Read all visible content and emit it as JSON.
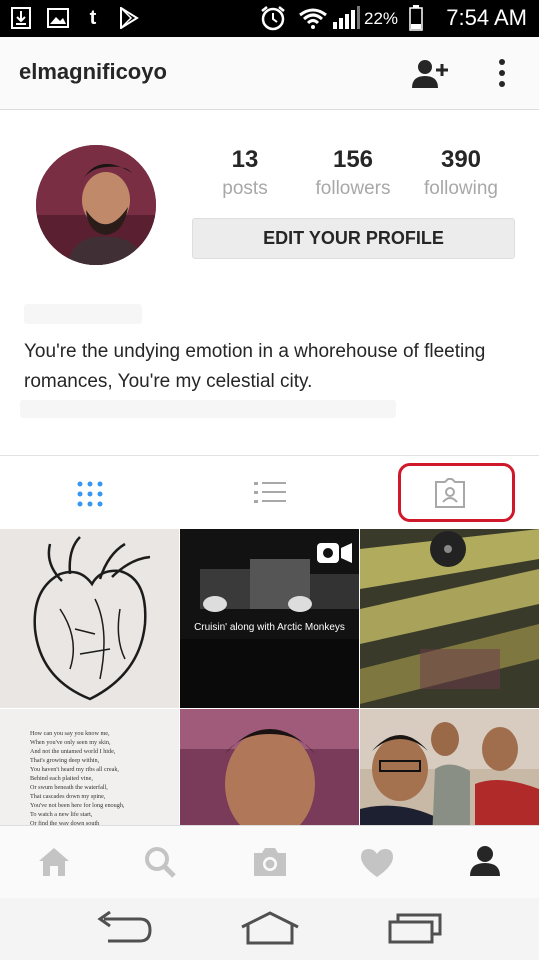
{
  "status_bar": {
    "battery_percent": "22%",
    "time": "7:54 AM",
    "icons": [
      "download-icon",
      "image-icon",
      "tumblr-icon",
      "play-store-icon",
      "alarm-icon",
      "wifi-icon",
      "signal-icon",
      "battery-icon"
    ]
  },
  "header": {
    "username": "elmagnificoyo",
    "icons": [
      "add-person-icon",
      "more-vertical-icon"
    ]
  },
  "profile": {
    "stats": [
      {
        "value": "13",
        "label": "posts"
      },
      {
        "value": "156",
        "label": "followers"
      },
      {
        "value": "390",
        "label": "following"
      }
    ],
    "edit_button": "EDIT YOUR PROFILE",
    "bio": "You're the undying emotion in a whorehouse of fleeting romances, You're my celestial city."
  },
  "tabs": {
    "items": [
      "grid-icon",
      "list-icon",
      "tagged-photos-icon"
    ],
    "active": "grid-icon",
    "highlight_color": "#d0182b"
  },
  "posts": [
    {
      "kind": "heart-sketch"
    },
    {
      "kind": "video",
      "caption": "Cruisin' along with Arctic Monkeys"
    },
    {
      "kind": "album-cover"
    },
    {
      "kind": "poem-text",
      "lines": [
        "How can you say you know me,",
        "When you've only seen my skin,",
        "And not the untamed world I hide,",
        "That's growing deep within,",
        "You haven't heard my ribs all creak,",
        "Behind each plaited vine,",
        "Or swum beneath the waterfall,",
        "That cascades down my spine,",
        "You've not been here for long enough,",
        "To watch a new life start,",
        "Or find the way down south"
      ]
    },
    {
      "kind": "selfie"
    },
    {
      "kind": "group-photo"
    }
  ],
  "bottom_nav": {
    "items": [
      "home-icon",
      "search-icon",
      "camera-icon",
      "heart-icon",
      "profile-icon"
    ],
    "active": "profile-icon"
  },
  "system_nav": {
    "items": [
      "back-icon",
      "home-button-icon",
      "recents-icon"
    ]
  },
  "colors": {
    "accent": "#3897f0",
    "text": "#262626",
    "muted": "#a8a8a8"
  }
}
